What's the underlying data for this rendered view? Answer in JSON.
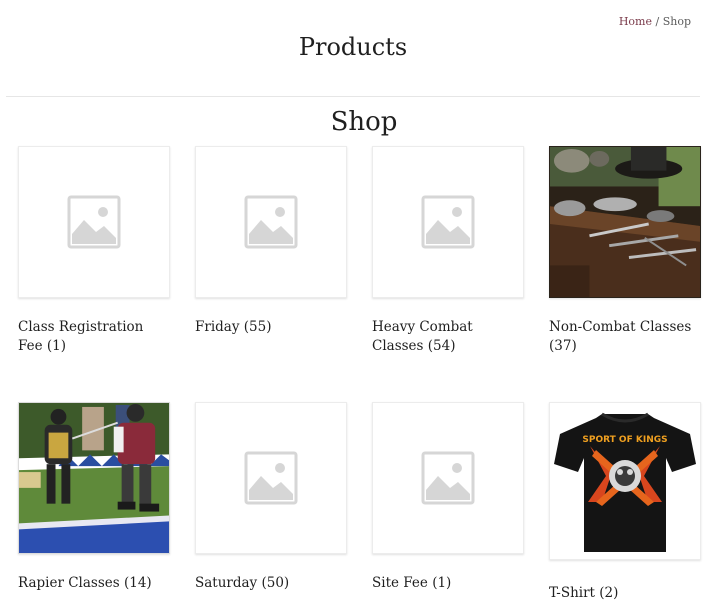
{
  "breadcrumb": {
    "home": "Home",
    "separator": " / ",
    "current": "Shop"
  },
  "page_title": "Products",
  "section_title": "Shop",
  "categories": [
    {
      "name": "Class Registration Fee",
      "count": "(1)",
      "image": "placeholder-icon"
    },
    {
      "name": "Friday",
      "count": "(55)",
      "image": "placeholder-icon"
    },
    {
      "name": "Heavy Combat Classes",
      "count": "(54)",
      "image": "placeholder-icon"
    },
    {
      "name": "Non-Combat Classes",
      "count": "(37)",
      "image": "craft-tools-photo"
    },
    {
      "name": "Rapier Classes",
      "count": "(14)",
      "image": "rapier-fencers-photo"
    },
    {
      "name": "Saturday",
      "count": "(50)",
      "image": "placeholder-icon"
    },
    {
      "name": "Site Fee",
      "count": "(1)",
      "image": "placeholder-icon"
    },
    {
      "name": "T-Shirt",
      "count": "(2)",
      "image": "black-tshirt-photo"
    }
  ],
  "tshirt_print": "SPORT OF KINGS",
  "colors": {
    "link": "#7a3b4b",
    "placeholder": "#d6d6d6",
    "text": "#1f1f1f"
  }
}
